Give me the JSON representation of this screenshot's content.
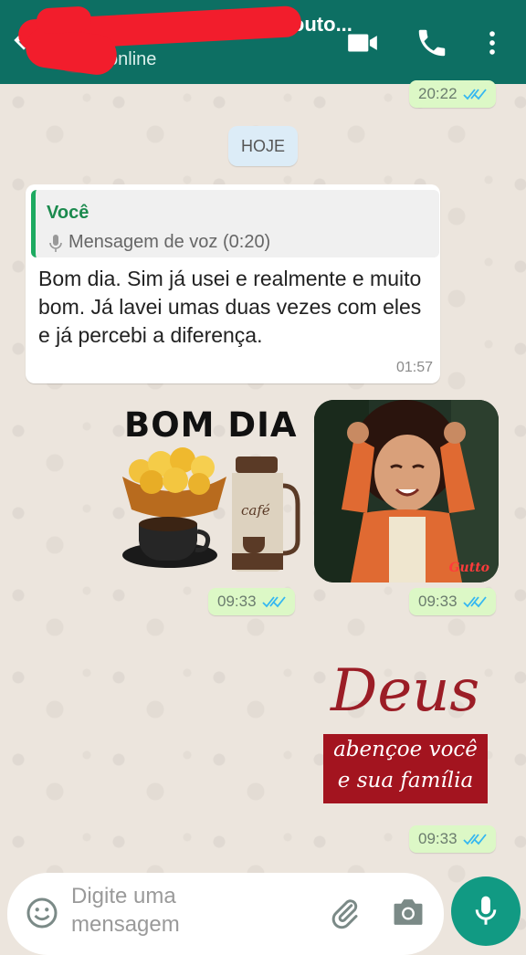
{
  "header": {
    "contact_name": "Maria Aparecida Souto...",
    "status": "online",
    "colors": {
      "bar": "#0d6f63",
      "redaction": "#f21d2c"
    },
    "icons": [
      "back-arrow-icon",
      "video-call-icon",
      "phone-call-icon",
      "more-options-icon"
    ]
  },
  "messages": {
    "prev_time": "20:22",
    "date_chip": "HOJE",
    "reply": {
      "quote_author": "Você",
      "quote_text": "Mensagem de voz (0:20)",
      "text": "Bom dia. Sim já usei e realmente e muito bom. Já lavei umas duas vezes com eles e já percebi a diferença.",
      "time": "01:57"
    },
    "sticker_bomdia": {
      "title": "BOM DIA",
      "thermos_label": "café",
      "time": "09:33"
    },
    "sticker_girl": {
      "signature": "Gutto",
      "time": "09:33"
    },
    "sticker_deus": {
      "title": "Deus",
      "line1": "abençoe você",
      "line2": "e sua família",
      "time": "09:33"
    }
  },
  "input": {
    "placeholder": "Digite uma mensagem",
    "icons": [
      "emoji-icon",
      "attach-icon",
      "camera-icon",
      "mic-icon"
    ]
  }
}
